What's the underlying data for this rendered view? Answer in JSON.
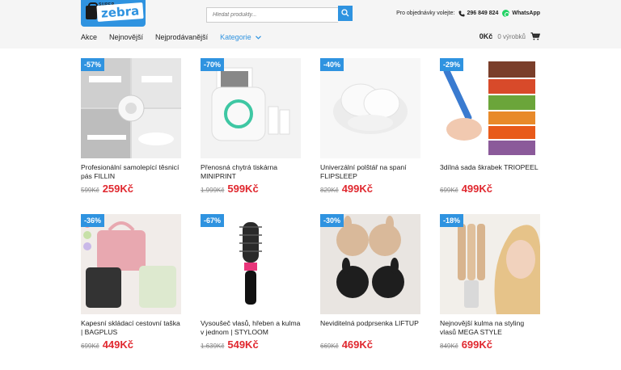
{
  "header": {
    "logo_small": "SUPER",
    "logo_word": "zebra",
    "search_placeholder": "Hledat produkty...",
    "contact_label": "Pro objednávky volejte:",
    "phone": "296 849 824",
    "whatsapp": "WhatsApp"
  },
  "nav": {
    "items": [
      "Akce",
      "Nejnovější",
      "Nejprodávanější"
    ],
    "category": "Kategorie"
  },
  "cart": {
    "total": "0Kč",
    "count": "0 výrobků"
  },
  "colors": {
    "accent": "#2f93e0",
    "price": "#e0282f"
  },
  "products": [
    {
      "discount": "-57%",
      "name": "Profesionální samolepící těsnicí pás FILLIN",
      "old_price": "599Kč",
      "price": "259Kč"
    },
    {
      "discount": "-70%",
      "name": "Přenosná chytrá tiskárna MINIPRINT",
      "old_price": "1.999Kč",
      "price": "599Kč"
    },
    {
      "discount": "-40%",
      "name": "Univerzální polštář na spaní FLIPSLEEP",
      "old_price": "829Kč",
      "price": "499Kč"
    },
    {
      "discount": "-29%",
      "name": "3dílná sada škrabek TRIOPEEL",
      "old_price": "699Kč",
      "price": "499Kč"
    },
    {
      "discount": "-36%",
      "name": "Kapesní skládací cestovní taška | BAGPLUS",
      "old_price": "699Kč",
      "price": "449Kč"
    },
    {
      "discount": "-67%",
      "name": "Vysoušeč vlasů, hřeben a kulma v jednom | STYLOOM",
      "old_price": "1.639Kč",
      "price": "549Kč"
    },
    {
      "discount": "-30%",
      "name": "Neviditelná podprsenka LIFTUP",
      "old_price": "669Kč",
      "price": "469Kč"
    },
    {
      "discount": "-18%",
      "name": "Nejnovější kulma na styling vlasů MEGA STYLE",
      "old_price": "849Kč",
      "price": "699Kč"
    }
  ]
}
